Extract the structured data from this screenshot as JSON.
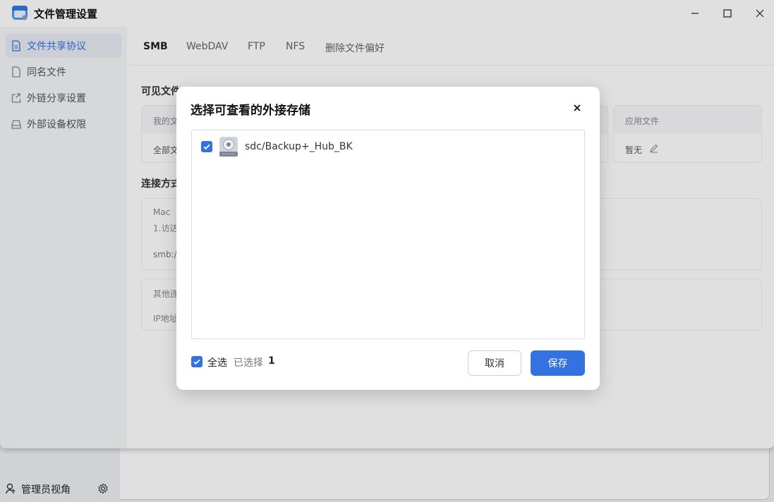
{
  "window": {
    "title": "文件管理设置"
  },
  "sidebar": {
    "items": [
      {
        "label": "文件共享协议",
        "active": true
      },
      {
        "label": "同名文件"
      },
      {
        "label": "外链分享设置"
      },
      {
        "label": "外部设备权限"
      }
    ]
  },
  "tabs": [
    "SMB",
    "WebDAV",
    "FTP",
    "NFS",
    "删除文件偏好"
  ],
  "content": {
    "visible_files_title": "可见文件",
    "table": {
      "col_my_files": "我的文",
      "row_all_files": "全部文",
      "col_app_files": "应用文件",
      "app_files_value": "暂无"
    },
    "connection_title": "连接方式",
    "mac_card": {
      "title": "Mac",
      "line1": "1.访达",
      "line2": "smb:/"
    },
    "other_card": {
      "title": "其他连",
      "line1": "IP地址"
    }
  },
  "footer": {
    "admin_label": "管理员视角"
  },
  "dialog": {
    "title": "选择可查看的外接存储",
    "items": [
      {
        "label": "sdc/Backup+_Hub_BK",
        "checked": true
      }
    ],
    "select_all_label": "全选",
    "selected_label": "已选择",
    "selected_count": "1",
    "cancel_label": "取消",
    "save_label": "保存"
  },
  "colors": {
    "accent": "#3372e0"
  }
}
